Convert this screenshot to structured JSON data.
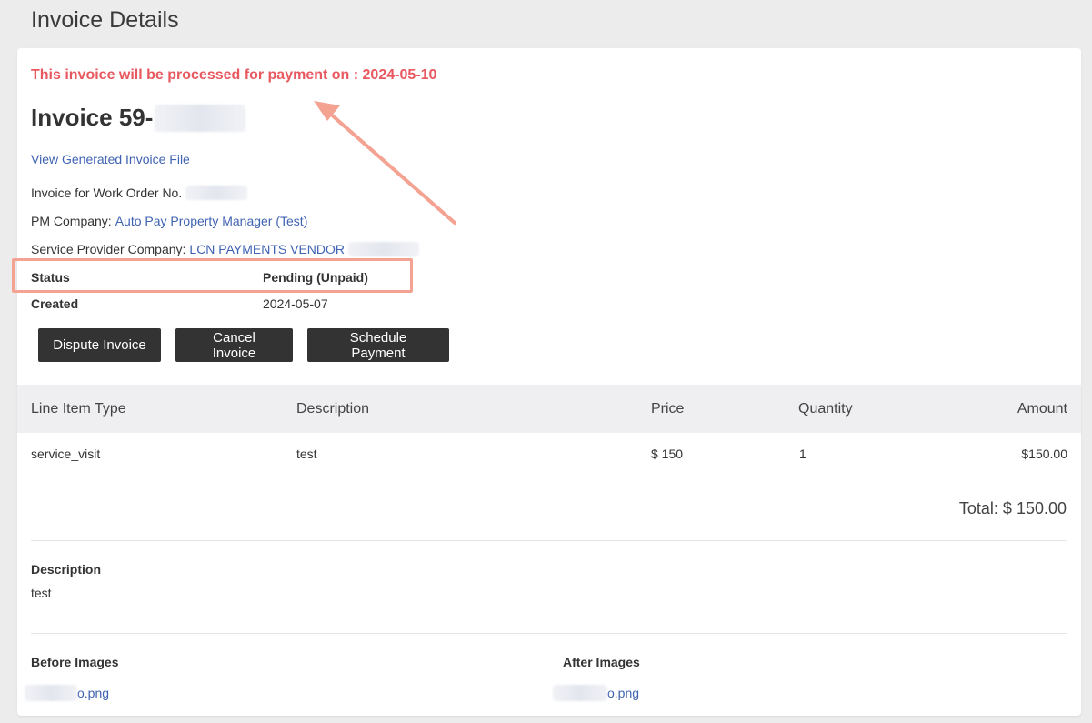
{
  "page": {
    "title": "Invoice Details"
  },
  "notice": "This invoice will be processed for payment on : 2024-05-10",
  "invoice": {
    "heading": "Invoice 59-",
    "view_file_link": "View Generated Invoice File",
    "work_order_label": "Invoice for Work Order No.",
    "pm_company_label": "PM Company:",
    "pm_company_value": "Auto Pay Property Manager (Test)",
    "provider_label": "Service Provider Company:",
    "provider_value": "LCN PAYMENTS VENDOR",
    "status_label": "Status",
    "status_value": "Pending (Unpaid)",
    "created_label": "Created",
    "created_value": "2024-05-07"
  },
  "buttons": {
    "dispute": "Dispute Invoice",
    "cancel": "Cancel Invoice",
    "schedule": "Schedule Payment"
  },
  "table": {
    "headers": [
      "Line Item Type",
      "Description",
      "Price",
      "Quantity",
      "Amount"
    ],
    "rows": [
      [
        "service_visit",
        "test",
        "$ 150",
        "1",
        "$150.00"
      ]
    ],
    "total": "Total: $ 150.00"
  },
  "description": {
    "label": "Description",
    "value": "test"
  },
  "images": {
    "before_label": "Before Images",
    "before_file": "o.png",
    "after_label": "After Images",
    "after_file": "o.png"
  },
  "colors": {
    "notice_red": "#e8585f",
    "link_blue": "#3f63b2",
    "annotation_salmon": "#f4a291",
    "button_dark": "#333333"
  }
}
